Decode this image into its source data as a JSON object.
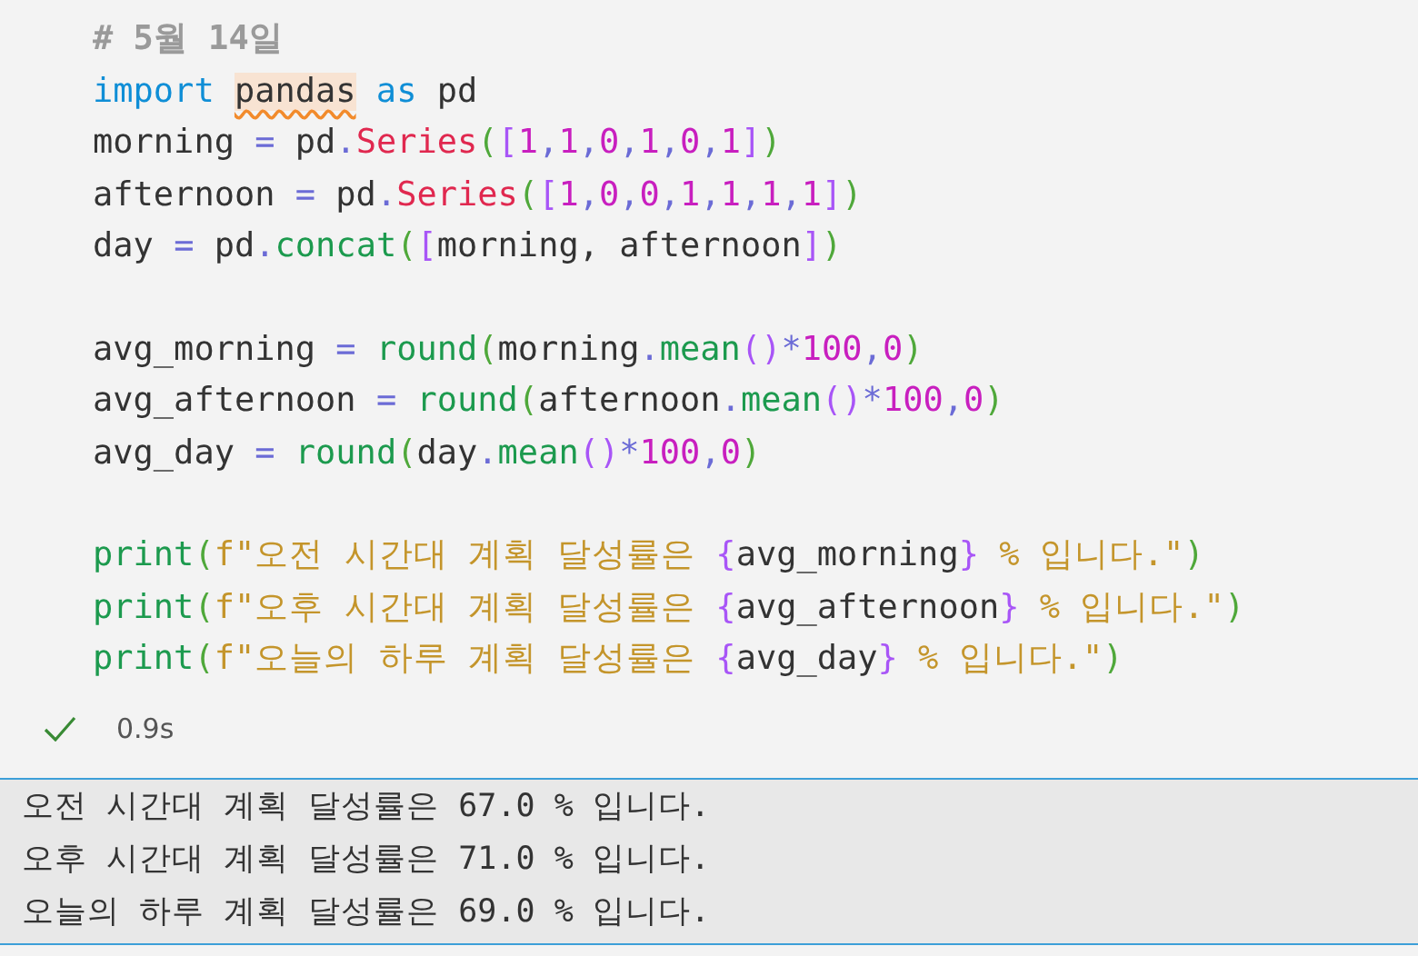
{
  "code_blocks": [
    [
      {
        "tokens": [
          {
            "kind": "comment",
            "text": "# 5월 14일"
          }
        ]
      },
      {
        "tokens": [
          {
            "kind": "keyword",
            "text": "import "
          },
          {
            "kind": "warning",
            "text": "pandas"
          },
          {
            "kind": "keyword",
            "text": " as"
          },
          {
            "kind": "plain",
            "text": " pd"
          }
        ]
      },
      {
        "tokens": [
          {
            "kind": "plain",
            "text": "morning "
          },
          {
            "kind": "operator",
            "text": "="
          },
          {
            "kind": "plain",
            "text": " pd"
          },
          {
            "kind": "operator",
            "text": "."
          },
          {
            "kind": "class",
            "text": "Series"
          },
          {
            "kind": "paren",
            "text": "("
          },
          {
            "kind": "bracket",
            "text": "["
          },
          {
            "kind": "number",
            "text": "1"
          },
          {
            "kind": "operator",
            "text": ","
          },
          {
            "kind": "number",
            "text": "1"
          },
          {
            "kind": "operator",
            "text": ","
          },
          {
            "kind": "number",
            "text": "0"
          },
          {
            "kind": "operator",
            "text": ","
          },
          {
            "kind": "number",
            "text": "1"
          },
          {
            "kind": "operator",
            "text": ","
          },
          {
            "kind": "number",
            "text": "0"
          },
          {
            "kind": "operator",
            "text": ","
          },
          {
            "kind": "number",
            "text": "1"
          },
          {
            "kind": "bracket",
            "text": "]"
          },
          {
            "kind": "paren",
            "text": ")"
          }
        ]
      },
      {
        "tokens": [
          {
            "kind": "plain",
            "text": "afternoon "
          },
          {
            "kind": "operator",
            "text": "="
          },
          {
            "kind": "plain",
            "text": " pd"
          },
          {
            "kind": "operator",
            "text": "."
          },
          {
            "kind": "class",
            "text": "Series"
          },
          {
            "kind": "paren",
            "text": "("
          },
          {
            "kind": "bracket",
            "text": "["
          },
          {
            "kind": "number",
            "text": "1"
          },
          {
            "kind": "operator",
            "text": ","
          },
          {
            "kind": "number",
            "text": "0"
          },
          {
            "kind": "operator",
            "text": ","
          },
          {
            "kind": "number",
            "text": "0"
          },
          {
            "kind": "operator",
            "text": ","
          },
          {
            "kind": "number",
            "text": "1"
          },
          {
            "kind": "operator",
            "text": ","
          },
          {
            "kind": "number",
            "text": "1"
          },
          {
            "kind": "operator",
            "text": ","
          },
          {
            "kind": "number",
            "text": "1"
          },
          {
            "kind": "operator",
            "text": ","
          },
          {
            "kind": "number",
            "text": "1"
          },
          {
            "kind": "bracket",
            "text": "]"
          },
          {
            "kind": "paren",
            "text": ")"
          }
        ]
      },
      {
        "tokens": [
          {
            "kind": "plain",
            "text": "day "
          },
          {
            "kind": "operator",
            "text": "="
          },
          {
            "kind": "plain",
            "text": " pd"
          },
          {
            "kind": "operator",
            "text": "."
          },
          {
            "kind": "function",
            "text": "concat"
          },
          {
            "kind": "paren",
            "text": "("
          },
          {
            "kind": "bracket",
            "text": "["
          },
          {
            "kind": "plain",
            "text": "morning, afternoon"
          },
          {
            "kind": "bracket",
            "text": "]"
          },
          {
            "kind": "paren",
            "text": ")"
          }
        ]
      }
    ],
    [
      {
        "tokens": [
          {
            "kind": "plain",
            "text": "avg_morning "
          },
          {
            "kind": "operator",
            "text": "= "
          },
          {
            "kind": "function",
            "text": "round"
          },
          {
            "kind": "paren",
            "text": "("
          },
          {
            "kind": "plain",
            "text": "morning"
          },
          {
            "kind": "operator",
            "text": "."
          },
          {
            "kind": "function",
            "text": "mean"
          },
          {
            "kind": "bracket",
            "text": "()"
          },
          {
            "kind": "operator",
            "text": "*"
          },
          {
            "kind": "number",
            "text": "100"
          },
          {
            "kind": "operator",
            "text": ","
          },
          {
            "kind": "number",
            "text": "0"
          },
          {
            "kind": "paren",
            "text": ")"
          }
        ]
      },
      {
        "tokens": [
          {
            "kind": "plain",
            "text": "avg_afternoon "
          },
          {
            "kind": "operator",
            "text": "= "
          },
          {
            "kind": "function",
            "text": "round"
          },
          {
            "kind": "paren",
            "text": "("
          },
          {
            "kind": "plain",
            "text": "afternoon"
          },
          {
            "kind": "operator",
            "text": "."
          },
          {
            "kind": "function",
            "text": "mean"
          },
          {
            "kind": "bracket",
            "text": "()"
          },
          {
            "kind": "operator",
            "text": "*"
          },
          {
            "kind": "number",
            "text": "100"
          },
          {
            "kind": "operator",
            "text": ","
          },
          {
            "kind": "number",
            "text": "0"
          },
          {
            "kind": "paren",
            "text": ")"
          }
        ]
      },
      {
        "tokens": [
          {
            "kind": "plain",
            "text": "avg_day "
          },
          {
            "kind": "operator",
            "text": "= "
          },
          {
            "kind": "function",
            "text": "round"
          },
          {
            "kind": "paren",
            "text": "("
          },
          {
            "kind": "plain",
            "text": "day"
          },
          {
            "kind": "operator",
            "text": "."
          },
          {
            "kind": "function",
            "text": "mean"
          },
          {
            "kind": "bracket",
            "text": "()"
          },
          {
            "kind": "operator",
            "text": "*"
          },
          {
            "kind": "number",
            "text": "100"
          },
          {
            "kind": "operator",
            "text": ","
          },
          {
            "kind": "number",
            "text": "0"
          },
          {
            "kind": "paren",
            "text": ")"
          }
        ]
      }
    ],
    [
      {
        "tokens": [
          {
            "kind": "function",
            "text": "print"
          },
          {
            "kind": "paren",
            "text": "("
          },
          {
            "kind": "string",
            "text": "f\"오전 시간대 계획 달성률은 "
          },
          {
            "kind": "bracket",
            "text": "{"
          },
          {
            "kind": "plain",
            "text": "avg_morning"
          },
          {
            "kind": "bracket",
            "text": "}"
          },
          {
            "kind": "string",
            "text": " % 입니다.\""
          },
          {
            "kind": "paren",
            "text": ")"
          }
        ]
      },
      {
        "tokens": [
          {
            "kind": "function",
            "text": "print"
          },
          {
            "kind": "paren",
            "text": "("
          },
          {
            "kind": "string",
            "text": "f\"오후 시간대 계획 달성률은 "
          },
          {
            "kind": "bracket",
            "text": "{"
          },
          {
            "kind": "plain",
            "text": "avg_afternoon"
          },
          {
            "kind": "bracket",
            "text": "}"
          },
          {
            "kind": "string",
            "text": " % 입니다.\""
          },
          {
            "kind": "paren",
            "text": ")"
          }
        ]
      },
      {
        "tokens": [
          {
            "kind": "function",
            "text": "print"
          },
          {
            "kind": "paren",
            "text": "("
          },
          {
            "kind": "string",
            "text": "f\"오늘의 하루 계획 달성률은 "
          },
          {
            "kind": "bracket",
            "text": "{"
          },
          {
            "kind": "plain",
            "text": "avg_day"
          },
          {
            "kind": "bracket",
            "text": "}"
          },
          {
            "kind": "string",
            "text": " % 입니다.\""
          },
          {
            "kind": "paren",
            "text": ")"
          }
        ]
      }
    ]
  ],
  "execution": {
    "succeeded": true,
    "duration": "0.9s"
  },
  "output_lines": [
    "오전 시간대 계획 달성률은 67.0 % 입니다.",
    "오후 시간대 계획 달성률은 71.0 % 입니다.",
    "오늘의 하루 계획 달성률은 69.0 % 입니다."
  ]
}
